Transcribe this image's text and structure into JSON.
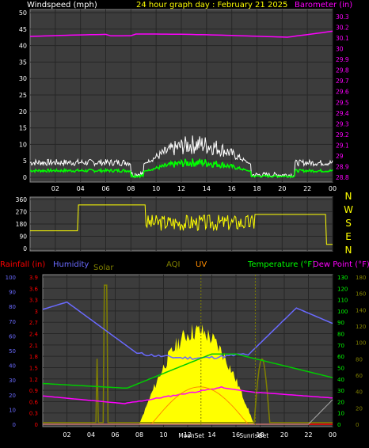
{
  "header": {
    "windspeed_title": "Windspeed (mph)",
    "graph_title": "24 hour graph day : February 21 2025",
    "barometer_title": "Barometer (in)"
  },
  "time_labels": [
    "02",
    "04",
    "06",
    "08",
    "10",
    "12",
    "14",
    "16",
    "18",
    "20",
    "22",
    "00"
  ],
  "wind_panel": {
    "y_ticks": [
      "50",
      "45",
      "40",
      "35",
      "30",
      "25",
      "20",
      "15",
      "10",
      "5",
      "0"
    ],
    "baro_ticks": [
      "30.3",
      "30.2",
      "30.1",
      "30",
      "29.9",
      "29.8",
      "29.7",
      "29.6",
      "29.5",
      "29.4",
      "29.3",
      "29.2",
      "29.1",
      "29",
      "28.9",
      "28.8"
    ]
  },
  "dir_panel": {
    "y_ticks": [
      "360",
      "270",
      "180",
      "90",
      "0"
    ],
    "compass": [
      "N",
      "W",
      "S",
      "E",
      "N"
    ]
  },
  "bottom_panel": {
    "legend": {
      "rainfall": "Rainfall (in)",
      "humidity": "Humidity",
      "solar": "Solar",
      "aqi": "AQI",
      "uv": "UV",
      "temperature": "Temperature (°F)",
      "dew_point": "Dew Point (°F)"
    },
    "rain_ticks": [
      "3.9",
      "3.6",
      "3.3",
      "3",
      "2.7",
      "2.4",
      "2.1",
      "1.8",
      "1.5",
      "1.2",
      "0.9",
      "0.6",
      "0.3",
      "0"
    ],
    "humidity_ticks": [
      "100",
      "90",
      "80",
      "70",
      "60",
      "50",
      "40",
      "30",
      "20",
      "10",
      "0"
    ],
    "temp_ticks": [
      "130",
      "120",
      "110",
      "100",
      "90",
      "80",
      "70",
      "60",
      "50",
      "40",
      "30",
      "20",
      "10",
      "0"
    ],
    "solar_ticks": [
      "180",
      "160",
      "140",
      "120",
      "100",
      "80",
      "60",
      "40",
      "20",
      "0"
    ],
    "event_labels": {
      "moonset": "MoonSet",
      "sunrise": "Sun",
      "sunset": "Set",
      "suffix": "rise"
    }
  },
  "colors": {
    "windspeed_title": "#ffffff",
    "graph_title": "#ffff00",
    "barometer": "#ff00ff",
    "rainfall": "#ff0000",
    "humidity": "#6a6aff",
    "solar": "#808000",
    "uv": "#ff8c00",
    "temperature": "#00ff00",
    "dew_point": "#ff00ff",
    "wind_gust": "#ffffff",
    "wind_avg": "#00ff00",
    "direction": "#ffff00",
    "panel_bg": "#3c3c3c",
    "grid": "#262626"
  }
}
